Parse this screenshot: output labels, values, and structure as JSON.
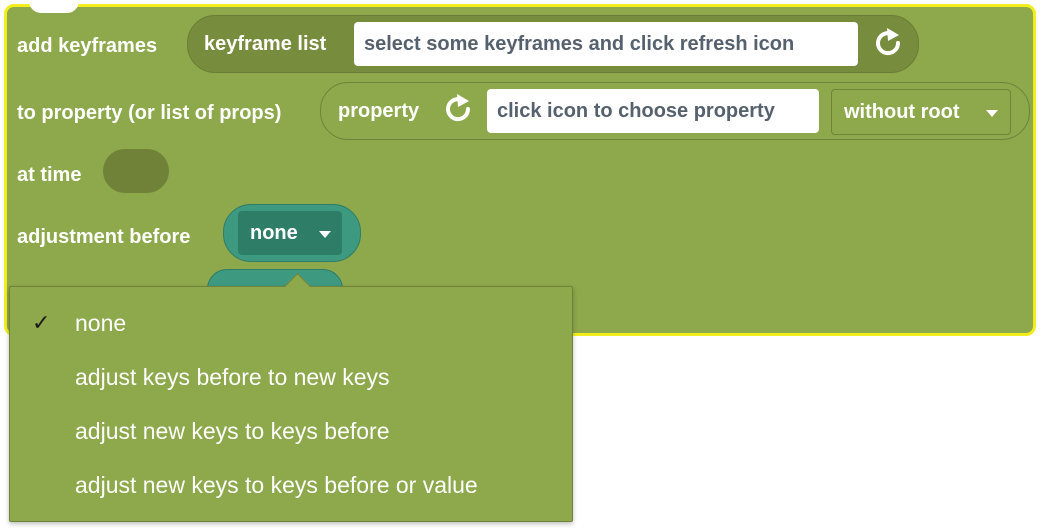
{
  "block": {
    "row1_label": "add keyframes",
    "keyframe_list_label": "keyframe list",
    "keyframe_field": "select some keyframes and click refresh icon",
    "row2_label": "to property (or list of props)",
    "property_label": "property",
    "property_field": "click icon to choose property",
    "root_dropdown": "without root",
    "row3_label": "at time",
    "row4_label": "adjustment before",
    "adjustment_value": "none"
  },
  "menu": {
    "items": [
      {
        "label": "none",
        "checked": true
      },
      {
        "label": "adjust keys before to new keys",
        "checked": false
      },
      {
        "label": "adjust new keys to keys before",
        "checked": false
      },
      {
        "label": "adjust new keys to keys before or value",
        "checked": false
      }
    ]
  },
  "colors": {
    "block": "#8ea84c",
    "block_border": "#f2ee1e",
    "slot": "#788c3e",
    "teal": "#3d9a80",
    "field_text": "#56616e"
  },
  "icons": [
    "refresh-icon",
    "caret-down-icon",
    "checkmark-icon"
  ]
}
